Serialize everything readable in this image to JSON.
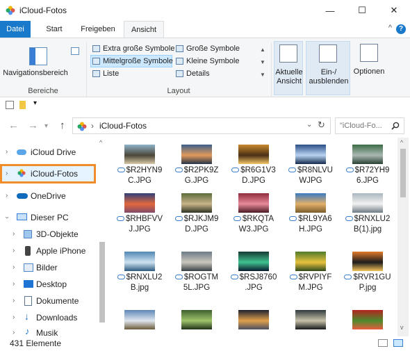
{
  "window": {
    "title": "iCloud-Fotos",
    "controls": {
      "minimize": "—",
      "maximize": "☐",
      "close": "✕"
    }
  },
  "ribbon": {
    "tabs": [
      {
        "label": "Datei",
        "kind": "file"
      },
      {
        "label": "Start",
        "kind": "normal"
      },
      {
        "label": "Freigeben",
        "kind": "normal"
      },
      {
        "label": "Ansicht",
        "kind": "active"
      }
    ],
    "collapse_glyph": "^",
    "help_glyph": "?",
    "groups": {
      "bereiche": {
        "label": "Bereiche",
        "nav_pane_button": "Navigationsbereich"
      },
      "layout": {
        "label": "Layout",
        "options": [
          {
            "label": "Extra große Symbole",
            "selected": false
          },
          {
            "label": "Große Symbole",
            "selected": false
          },
          {
            "label": "Mittelgroße Symbole",
            "selected": true
          },
          {
            "label": "Kleine Symbole",
            "selected": false
          },
          {
            "label": "Liste",
            "selected": false
          },
          {
            "label": "Details",
            "selected": false
          }
        ]
      },
      "current_view": {
        "line1": "Aktuelle",
        "line2": "Ansicht"
      },
      "show_hide": {
        "line1": "Ein-/",
        "line2": "ausblenden"
      },
      "options": {
        "label": "Optionen"
      }
    }
  },
  "address_bar": {
    "path": "iCloud-Fotos",
    "search_placeholder": "\"iCloud-Fo..."
  },
  "nav_pane": {
    "items": [
      {
        "label": "iCloud Drive",
        "icon": "cloud-icon",
        "indent": 0,
        "expandable": true
      },
      {
        "label": "iCloud-Fotos",
        "icon": "photos-icon",
        "indent": 0,
        "expandable": true,
        "highlighted": true
      },
      {
        "label": "OneDrive",
        "icon": "onedrive-icon",
        "indent": 0,
        "expandable": true
      },
      {
        "label": "Dieser PC",
        "icon": "computer-icon",
        "indent": 0,
        "expanded": true
      },
      {
        "label": "3D-Objekte",
        "icon": "cube-icon",
        "indent": 1,
        "expandable": true
      },
      {
        "label": "Apple iPhone",
        "icon": "phone-icon",
        "indent": 1,
        "expandable": true
      },
      {
        "label": "Bilder",
        "icon": "pictures-icon",
        "indent": 1,
        "expandable": true
      },
      {
        "label": "Desktop",
        "icon": "desktop-icon",
        "indent": 1,
        "expandable": true
      },
      {
        "label": "Dokumente",
        "icon": "documents-icon",
        "indent": 1,
        "expandable": true
      },
      {
        "label": "Downloads",
        "icon": "download-icon",
        "indent": 1,
        "expandable": true
      },
      {
        "label": "Musik",
        "icon": "music-icon",
        "indent": 1,
        "expandable": true
      }
    ]
  },
  "files": [
    {
      "line1": "$R2HYN9",
      "line2": "C.JPG",
      "colors": [
        "#8fb3c9",
        "#4b4638",
        "#d9c9a7"
      ]
    },
    {
      "line1": "$R2PK9Z",
      "line2": "G.JPG",
      "colors": [
        "#3c5f89",
        "#e19a5a",
        "#24344a"
      ]
    },
    {
      "line1": "$R6G1V3",
      "line2": "D.JPG",
      "colors": [
        "#c98a2e",
        "#4b2f15",
        "#f2c766"
      ]
    },
    {
      "line1": "$R8NLVU",
      "line2": "WJPG",
      "colors": [
        "#2a4e86",
        "#b9d3f2",
        "#13294d"
      ]
    },
    {
      "line1": "$R72YH9",
      "line2": "6.JPG",
      "colors": [
        "#3e6b46",
        "#aab8b3",
        "#274030"
      ]
    },
    {
      "line1": "$RHBFVV",
      "line2": "J.JPG",
      "colors": [
        "#2f3f7a",
        "#e2683c",
        "#7f4a6a"
      ]
    },
    {
      "line1": "$RJKJM9",
      "line2": "D.JPG",
      "colors": [
        "#5c6b3a",
        "#c8b48a",
        "#2c3322"
      ]
    },
    {
      "line1": "$RKQTA",
      "line2": "W3.JPG",
      "colors": [
        "#8e2c3f",
        "#e78a9a",
        "#4a1a24"
      ]
    },
    {
      "line1": "$RL9YA6",
      "line2": "H.JPG",
      "colors": [
        "#3a7cc2",
        "#e3b06a",
        "#7a5b2d"
      ]
    },
    {
      "line1": "$RNXLU2",
      "line2": "B(1).jpg",
      "colors": [
        "#aab7bf",
        "#f2f2f2",
        "#6d7b84"
      ]
    },
    {
      "line1": "$RNXLU2",
      "line2": "B.jpg",
      "colors": [
        "#4f86b3",
        "#cfe3f1",
        "#2d5a80"
      ]
    },
    {
      "line1": "$ROGTM",
      "line2": "5L.JPG",
      "colors": [
        "#6c7a86",
        "#c9c6bc",
        "#3a4046"
      ]
    },
    {
      "line1": "$RSJ8760",
      "line2": ".JPG",
      "colors": [
        "#153a33",
        "#3fc28e",
        "#0a1a2e"
      ]
    },
    {
      "line1": "$RVPIYF",
      "line2": "M.JPG",
      "colors": [
        "#4f7a2a",
        "#e8c23e",
        "#2e4a1a"
      ]
    },
    {
      "line1": "$RVR1GU",
      "line2": "P.jpg",
      "colors": [
        "#e07b2a",
        "#1c1c1c",
        "#f5c35a"
      ]
    },
    {
      "line1": "",
      "line2": "",
      "colors": [
        "#5d86b6",
        "#dfe6ee",
        "#6d5a3a"
      ]
    },
    {
      "line1": "",
      "line2": "",
      "colors": [
        "#3d5f2e",
        "#9fc36b",
        "#1f3018"
      ]
    },
    {
      "line1": "",
      "line2": "",
      "colors": [
        "#1d2030",
        "#e0a04a",
        "#4a4f62"
      ]
    },
    {
      "line1": "",
      "line2": "",
      "colors": [
        "#2f3a3e",
        "#c9c2aa",
        "#14191b"
      ]
    },
    {
      "line1": "",
      "line2": "",
      "colors": [
        "#b3231f",
        "#4c8a2c",
        "#e85b3c"
      ]
    }
  ],
  "status": {
    "count_text": "431 Elemente"
  }
}
